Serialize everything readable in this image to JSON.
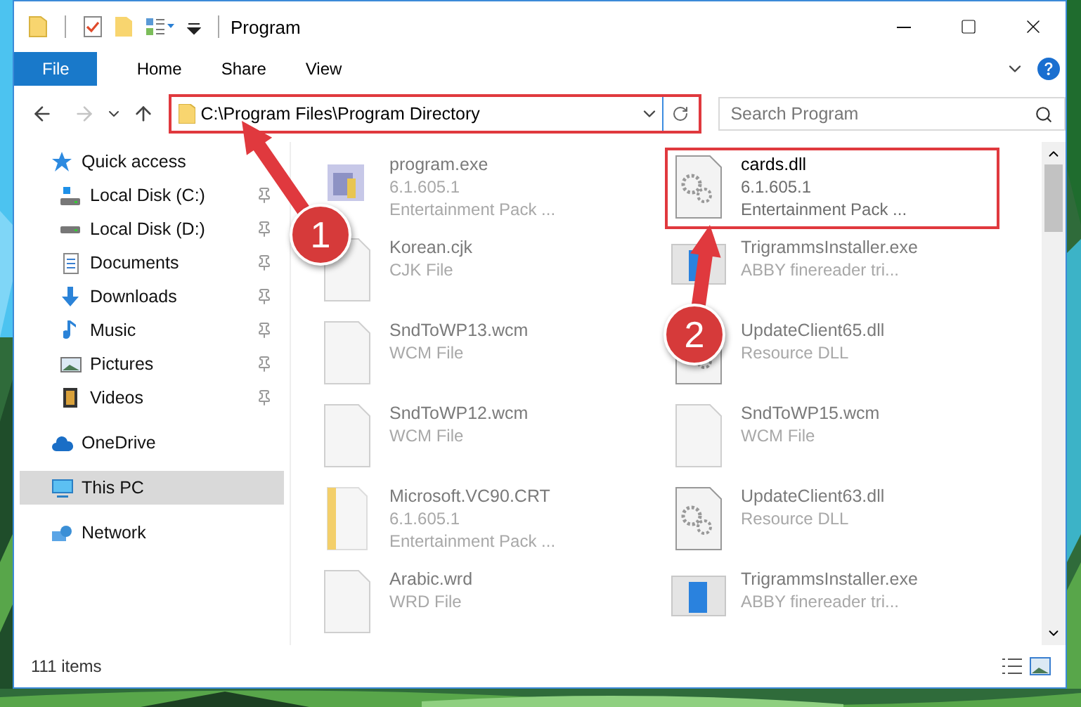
{
  "window": {
    "title": "Program"
  },
  "ribbon": {
    "tabs": [
      {
        "label": "File",
        "kind": "file"
      },
      {
        "label": "Home",
        "kind": "tab"
      },
      {
        "label": "Share",
        "kind": "tab"
      },
      {
        "label": "View",
        "kind": "tab"
      }
    ]
  },
  "address_bar": {
    "path": "C:\\Program Files\\Program Directory",
    "highlighted": true
  },
  "search": {
    "placeholder": "Search Program"
  },
  "navigation": [
    {
      "label": "Quick access",
      "kind": "star",
      "selected": false,
      "children": [
        {
          "label": "Local Disk (C:)",
          "kind": "system-drive",
          "pinned": true,
          "selected": false
        },
        {
          "label": "Local Disk (D:)",
          "kind": "drive",
          "pinned": true,
          "selected": false
        },
        {
          "label": "Documents",
          "kind": "documents",
          "pinned": true,
          "selected": false
        },
        {
          "label": "Downloads",
          "kind": "downloads",
          "pinned": true,
          "selected": false
        },
        {
          "label": "Music",
          "kind": "music",
          "pinned": true,
          "selected": false
        },
        {
          "label": "Pictures",
          "kind": "pictures",
          "pinned": true,
          "selected": false
        },
        {
          "label": "Videos",
          "kind": "videos",
          "pinned": true,
          "selected": false
        }
      ]
    },
    {
      "label": "OneDrive",
      "kind": "cloud",
      "selected": false
    },
    {
      "label": "This PC",
      "kind": "computer",
      "selected": true
    },
    {
      "label": "Network",
      "kind": "network",
      "selected": false
    }
  ],
  "files": [
    {
      "name": "program.exe",
      "details": [
        "6.1.605.1",
        "Entertainment Pack ..."
      ],
      "kind": "program",
      "faded": true,
      "highlighted": false
    },
    {
      "name": "cards.dll",
      "details": [
        "6.1.605.1",
        "Entertainment Pack ..."
      ],
      "kind": "settings",
      "faded": false,
      "highlighted": true
    },
    {
      "name": "Korean.cjk",
      "details": [
        "CJK File"
      ],
      "kind": "blank",
      "faded": true,
      "highlighted": false
    },
    {
      "name": "TrigrammsInstaller.exe",
      "details": [
        "ABBY finereader tri..."
      ],
      "kind": "installer",
      "faded": true,
      "highlighted": false
    },
    {
      "name": "SndToWP13.wcm",
      "details": [
        "WCM File"
      ],
      "kind": "blank",
      "faded": true,
      "highlighted": false
    },
    {
      "name": "UpdateClient65.dll",
      "details": [
        "Resource DLL"
      ],
      "kind": "settings",
      "faded": true,
      "highlighted": false
    },
    {
      "name": "SndToWP12.wcm",
      "details": [
        "WCM File"
      ],
      "kind": "blank",
      "faded": true,
      "highlighted": false
    },
    {
      "name": "SndToWP15.wcm",
      "details": [
        "WCM File"
      ],
      "kind": "blank",
      "faded": true,
      "highlighted": false
    },
    {
      "name": "Microsoft.VC90.CRT",
      "details": [
        "6.1.605.1",
        "Entertainment Pack ..."
      ],
      "kind": "package",
      "faded": true,
      "highlighted": false
    },
    {
      "name": "UpdateClient63.dll",
      "details": [
        "Resource DLL"
      ],
      "kind": "settings",
      "faded": true,
      "highlighted": false
    },
    {
      "name": "Arabic.wrd",
      "details": [
        "WRD File"
      ],
      "kind": "blank",
      "faded": true,
      "highlighted": false
    },
    {
      "name": "TrigrammsInstaller.exe",
      "details": [
        "ABBY finereader tri..."
      ],
      "kind": "installer",
      "faded": true,
      "highlighted": false
    }
  ],
  "status_bar": {
    "item_count": "111 items"
  },
  "annotations": [
    {
      "label": "1"
    },
    {
      "label": "2"
    }
  ]
}
